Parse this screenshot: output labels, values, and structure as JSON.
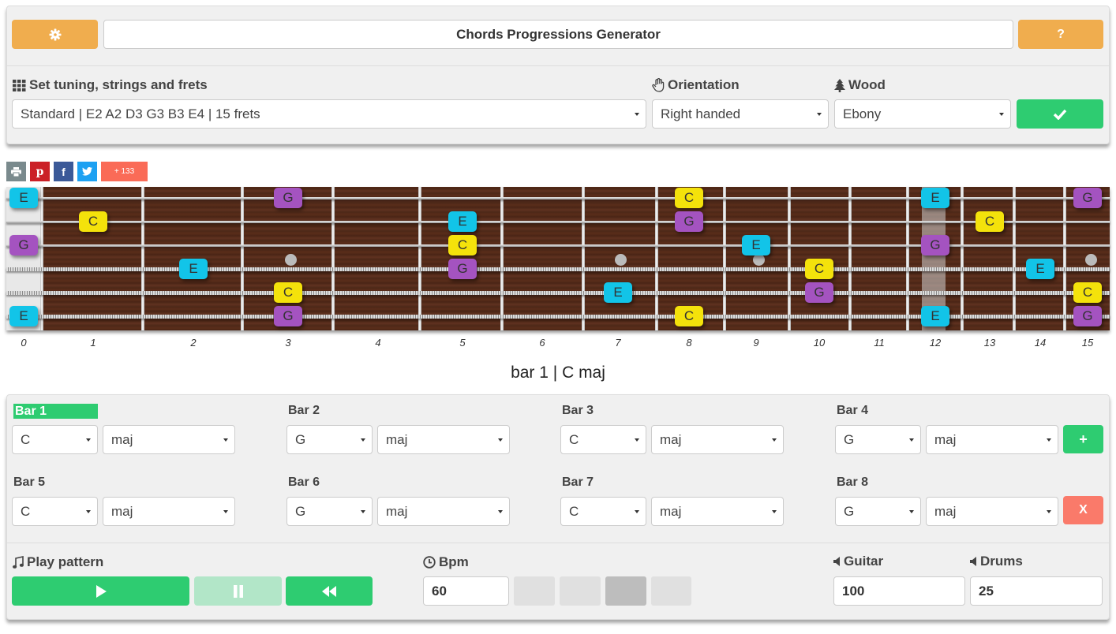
{
  "app": {
    "title": "Chords Progressions Generator",
    "help_label": "?"
  },
  "settings": {
    "tuning_label": "Set tuning, strings and frets",
    "tuning_value": "Standard | E2 A2 D3 G3 B3 E4 | 15 frets",
    "orientation_label": "Orientation",
    "orientation_value": "Right handed",
    "wood_label": "Wood",
    "wood_value": "Ebony"
  },
  "share": {
    "count_label": "+ 133"
  },
  "colors": {
    "E": "#12c4e8",
    "C": "#f4e20b",
    "G": "#a453c0",
    "accent": "#2ecc71",
    "orange": "#f0ad4e",
    "red": "#fa7a6a"
  },
  "fret_numbers": [
    "0",
    "1",
    "2",
    "3",
    "4",
    "5",
    "6",
    "7",
    "8",
    "9",
    "10",
    "11",
    "12",
    "13",
    "14",
    "15"
  ],
  "fretboard_notes": [
    {
      "string": 1,
      "fret": 0,
      "note": "E"
    },
    {
      "string": 1,
      "fret": 3,
      "note": "G"
    },
    {
      "string": 1,
      "fret": 8,
      "note": "C"
    },
    {
      "string": 1,
      "fret": 12,
      "note": "E"
    },
    {
      "string": 1,
      "fret": 15,
      "note": "G"
    },
    {
      "string": 2,
      "fret": 1,
      "note": "C"
    },
    {
      "string": 2,
      "fret": 5,
      "note": "E"
    },
    {
      "string": 2,
      "fret": 8,
      "note": "G"
    },
    {
      "string": 2,
      "fret": 13,
      "note": "C"
    },
    {
      "string": 3,
      "fret": 0,
      "note": "G"
    },
    {
      "string": 3,
      "fret": 5,
      "note": "C"
    },
    {
      "string": 3,
      "fret": 9,
      "note": "E"
    },
    {
      "string": 3,
      "fret": 12,
      "note": "G"
    },
    {
      "string": 4,
      "fret": 2,
      "note": "E"
    },
    {
      "string": 4,
      "fret": 5,
      "note": "G"
    },
    {
      "string": 4,
      "fret": 10,
      "note": "C"
    },
    {
      "string": 4,
      "fret": 14,
      "note": "E"
    },
    {
      "string": 5,
      "fret": 3,
      "note": "C"
    },
    {
      "string": 5,
      "fret": 7,
      "note": "E"
    },
    {
      "string": 5,
      "fret": 10,
      "note": "G"
    },
    {
      "string": 5,
      "fret": 15,
      "note": "C"
    },
    {
      "string": 6,
      "fret": 0,
      "note": "E"
    },
    {
      "string": 6,
      "fret": 3,
      "note": "G"
    },
    {
      "string": 6,
      "fret": 8,
      "note": "C"
    },
    {
      "string": 6,
      "fret": 12,
      "note": "E"
    },
    {
      "string": 6,
      "fret": 15,
      "note": "G"
    }
  ],
  "current_bar": "bar 1 | C maj",
  "bars": [
    {
      "label": "Bar 1",
      "root": "C",
      "quality": "maj",
      "active": true
    },
    {
      "label": "Bar 2",
      "root": "G",
      "quality": "maj",
      "active": false
    },
    {
      "label": "Bar 3",
      "root": "C",
      "quality": "maj",
      "active": false
    },
    {
      "label": "Bar 4",
      "root": "G",
      "quality": "maj",
      "active": false
    },
    {
      "label": "Bar 5",
      "root": "C",
      "quality": "maj",
      "active": false
    },
    {
      "label": "Bar 6",
      "root": "G",
      "quality": "maj",
      "active": false
    },
    {
      "label": "Bar 7",
      "root": "C",
      "quality": "maj",
      "active": false
    },
    {
      "label": "Bar 8",
      "root": "G",
      "quality": "maj",
      "active": false
    }
  ],
  "controls": {
    "add_label": "+",
    "remove_label": "X",
    "play_pattern_label": "Play pattern",
    "bpm_label": "Bpm",
    "bpm_value": "60",
    "guitar_label": "Guitar",
    "guitar_value": "100",
    "drums_label": "Drums",
    "drums_value": "25"
  }
}
